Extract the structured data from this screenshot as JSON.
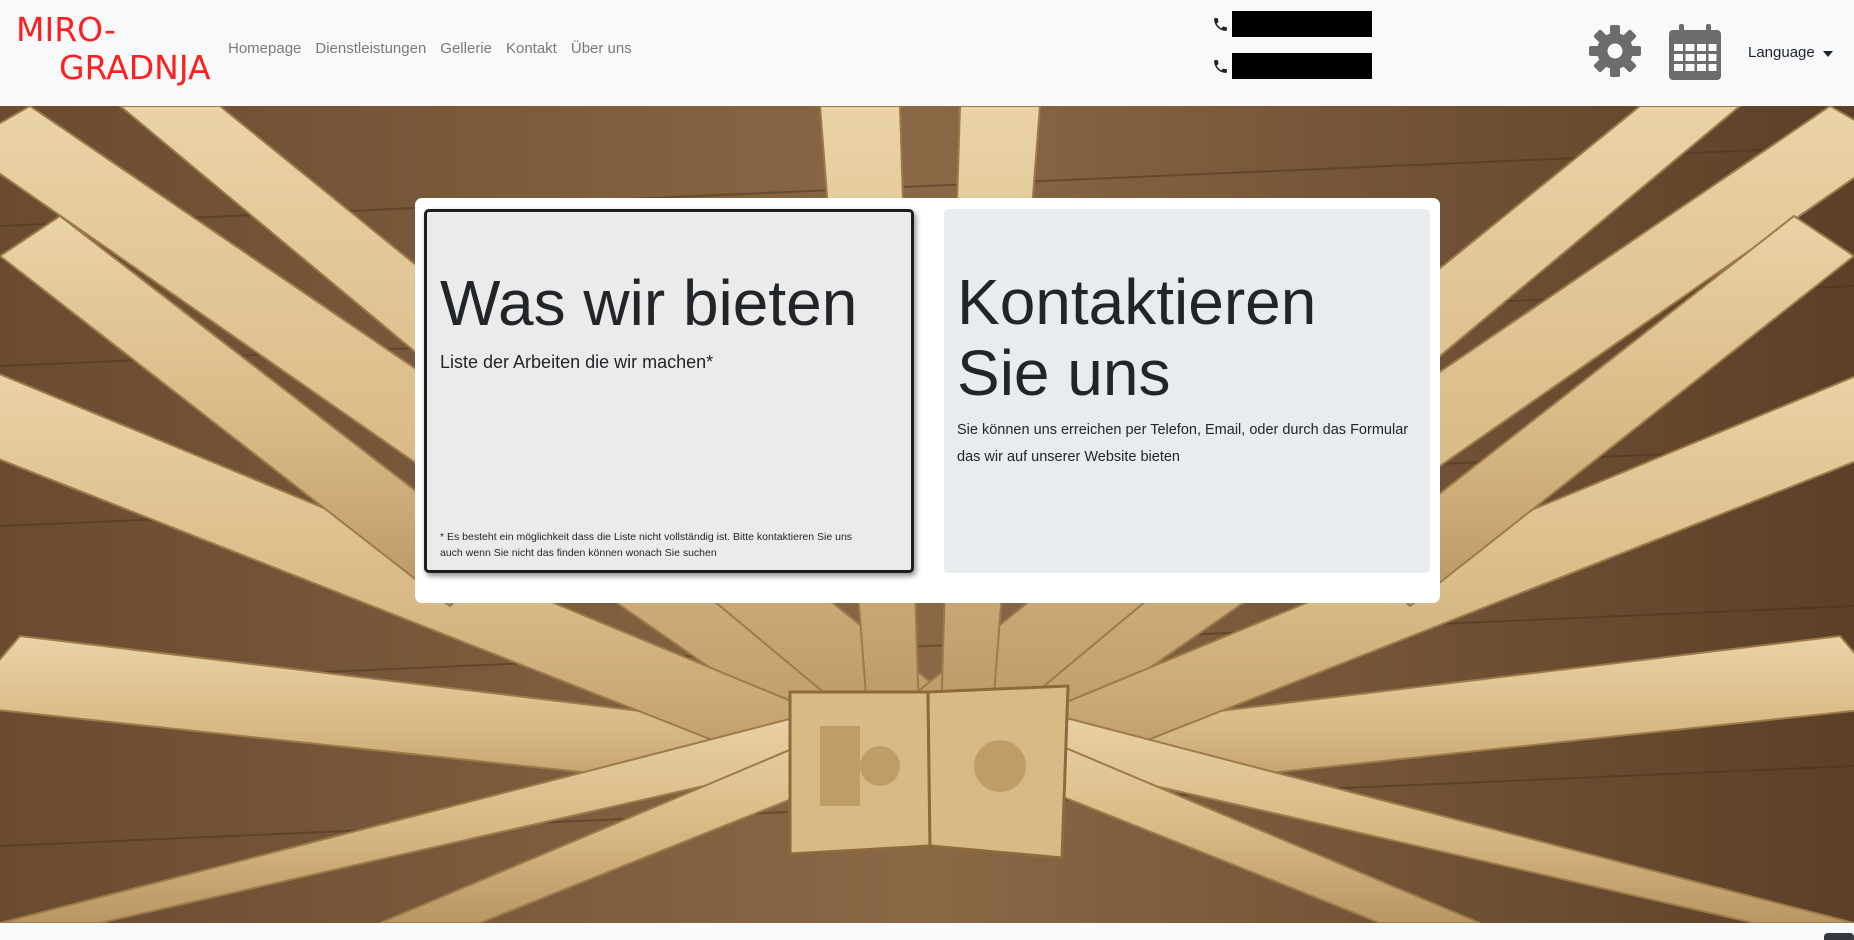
{
  "brand": {
    "line1": "MIRO-",
    "line2": "GRADNJA",
    "color": "#ff1f1f"
  },
  "nav": {
    "items": [
      {
        "label": "Homepage"
      },
      {
        "label": "Dienstleistungen"
      },
      {
        "label": "Gellerie"
      },
      {
        "label": "Kontakt"
      },
      {
        "label": "Über uns"
      }
    ]
  },
  "contact": {
    "phone_icon": "phone-icon",
    "phone1": "",
    "phone2": ""
  },
  "tools": {
    "settings_icon": "gear-icon",
    "calendar_icon": "calendar-icon"
  },
  "language": {
    "label": "Language"
  },
  "cards": {
    "offer": {
      "title": "Was wir bieten",
      "lead": "Liste der Arbeiten die wir machen*",
      "footnote": "* Es besteht ein möglichkeit dass die Liste nicht vollständig ist. Bitte kontaktieren Sie uns auch wenn Sie nicht das finden können wonach Sie suchen"
    },
    "contact": {
      "title": "Kontaktieren Sie uns",
      "body": "Sie können uns erreichen per Telefon, Email, oder durch das Formular das wir auf unserer Website bieten"
    }
  },
  "colors": {
    "navbar_bg": "#f8f9fa",
    "wood": "#dcc08e",
    "text": "#212529"
  }
}
